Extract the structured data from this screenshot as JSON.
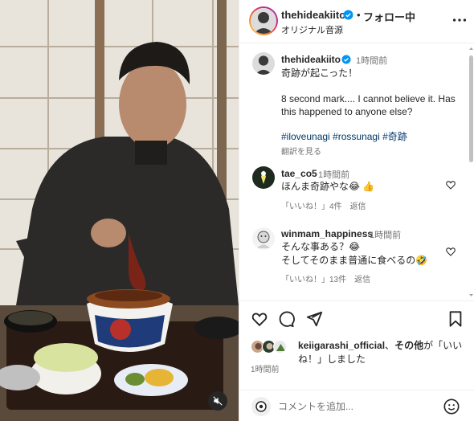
{
  "header": {
    "username": "thehideakiito",
    "dot": "•",
    "follow_label": "フォロー中",
    "audio": "オリジナル音源"
  },
  "caption": {
    "username": "thehideakiito",
    "time": "1時間前",
    "line1": "奇跡が起こった！",
    "line2": "8 second mark.... I cannot believe it. Has",
    "line3": "this happened to anyone else?",
    "hashtags": "#iloveunagi #rossunagi #奇跡",
    "translate": "翻訳を見る"
  },
  "comments": [
    {
      "username": "tae_co5",
      "time": "1時間前",
      "text": "ほんま奇跡やな😂 👍",
      "likes_label": "「いいね！」",
      "likes": "4件",
      "reply": "返信"
    },
    {
      "username": "winmam_happiness",
      "time": "1時間前",
      "text": "そんな事ある？😂\nそしてそのまま普通に食べるの🤣",
      "likes_label": "「いいね！」",
      "likes": "13件",
      "reply": "返信"
    }
  ],
  "likes": {
    "user": "keiigarashi_official",
    "mid": "、",
    "others": "その他",
    "suffix": "が「いいね！」しました"
  },
  "post_time": "1時間前",
  "comment_placeholder": "コメントを追加...",
  "icons": [
    "verified-icon",
    "more-icon",
    "heart-icon",
    "comment-icon",
    "share-icon",
    "bookmark-icon",
    "emoji-icon",
    "mute-icon"
  ],
  "colors": {
    "verified": "#0095f6",
    "hashtag": "#00376b",
    "muted": "#737373",
    "avatar_ring": "#d62976"
  }
}
